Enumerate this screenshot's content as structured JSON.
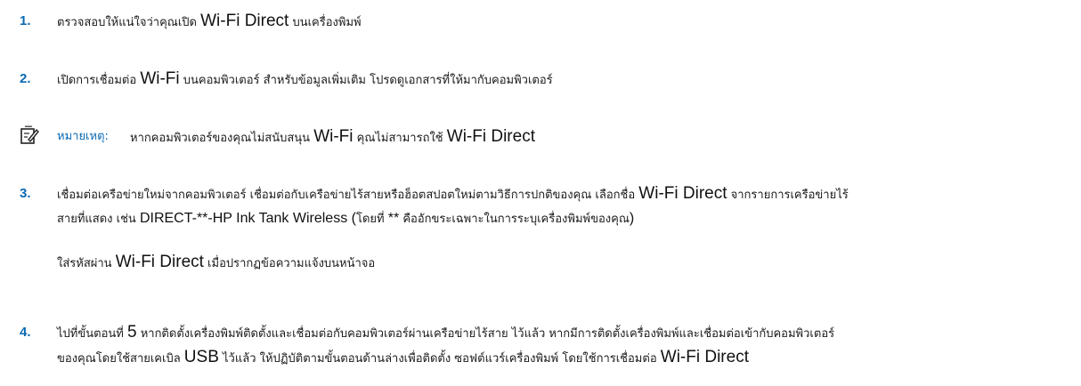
{
  "steps": [
    {
      "number": "1.",
      "parts": [
        "ตรวจสอบให้แน่ใจว่าคุณเปิด ",
        "Wi-Fi Direct",
        " บนเครื่องพิมพ์"
      ]
    },
    {
      "number": "2.",
      "parts": [
        "เปิดการเชื่อมต่อ ",
        "Wi-Fi",
        " บนคอมพิวเตอร์ สำหรับข้อมูลเพิ่มเติม โปรดดูเอกสารที่ให้มากับคอมพิวเตอร์"
      ]
    },
    {
      "number": "3.",
      "line1": [
        "เชื่อมต่อเครือข่ายใหม่จากคอมพิวเตอร์ เชื่อมต่อกับเครือข่ายไร้สายหรือฮ็อตสปอตใหม่ตามวิธีการปกติของคุณ เลือกชื่อ ",
        "Wi-Fi Direct",
        " จากรายการเครือข่ายไร้"
      ],
      "line2": [
        "สายที่แสดง เช่น ",
        "DIRECT-**-HP Ink Tank Wireless",
        " (",
        "โดยที่ ",
        "**",
        " คืออักขระเฉพาะในการระบุเครื่องพิมพ์ของคุณ",
        ")"
      ],
      "sub": [
        "ใส่รหัสผ่าน ",
        "Wi-Fi Direct",
        " เมื่อปรากฏข้อความแจ้งบนหน้าจอ"
      ]
    },
    {
      "number": "4.",
      "line1": [
        "ไปที่ขั้นตอนที่ ",
        "5",
        " หากติดตั้งเครื่องพิมพ์ติดตั้งและเชื่อมต่อกับคอมพิวเตอร์ผ่านเครือข่ายไร้สาย ไว้แล้ว หากมีการติดตั้งเครื่องพิมพ์และเชื่อมต่อเข้ากับคอมพิวเตอร์"
      ],
      "line2": [
        "ของคุณโดยใช้สายเคเบิล ",
        "USB",
        " ไว้แล้ว ให้ปฏิบัติตามขั้นตอนด้านล่างเพื่อติดตั้ง ซอฟต์แวร์เครื่องพิมพ์ โดยใช้การเชื่อมต่อ ",
        "Wi-Fi Direct"
      ]
    }
  ],
  "note": {
    "icon": "note-pencil-icon",
    "label": "หมายเหตุ:",
    "parts": [
      "หากคอมพิวเตอร์ของคุณไม่สนับสนุน ",
      "Wi-Fi",
      " คุณไม่สามารถใช้ ",
      "Wi-Fi Direct"
    ]
  },
  "colors": {
    "accent": "#0a6ab3",
    "text": "#1a1a1a"
  }
}
